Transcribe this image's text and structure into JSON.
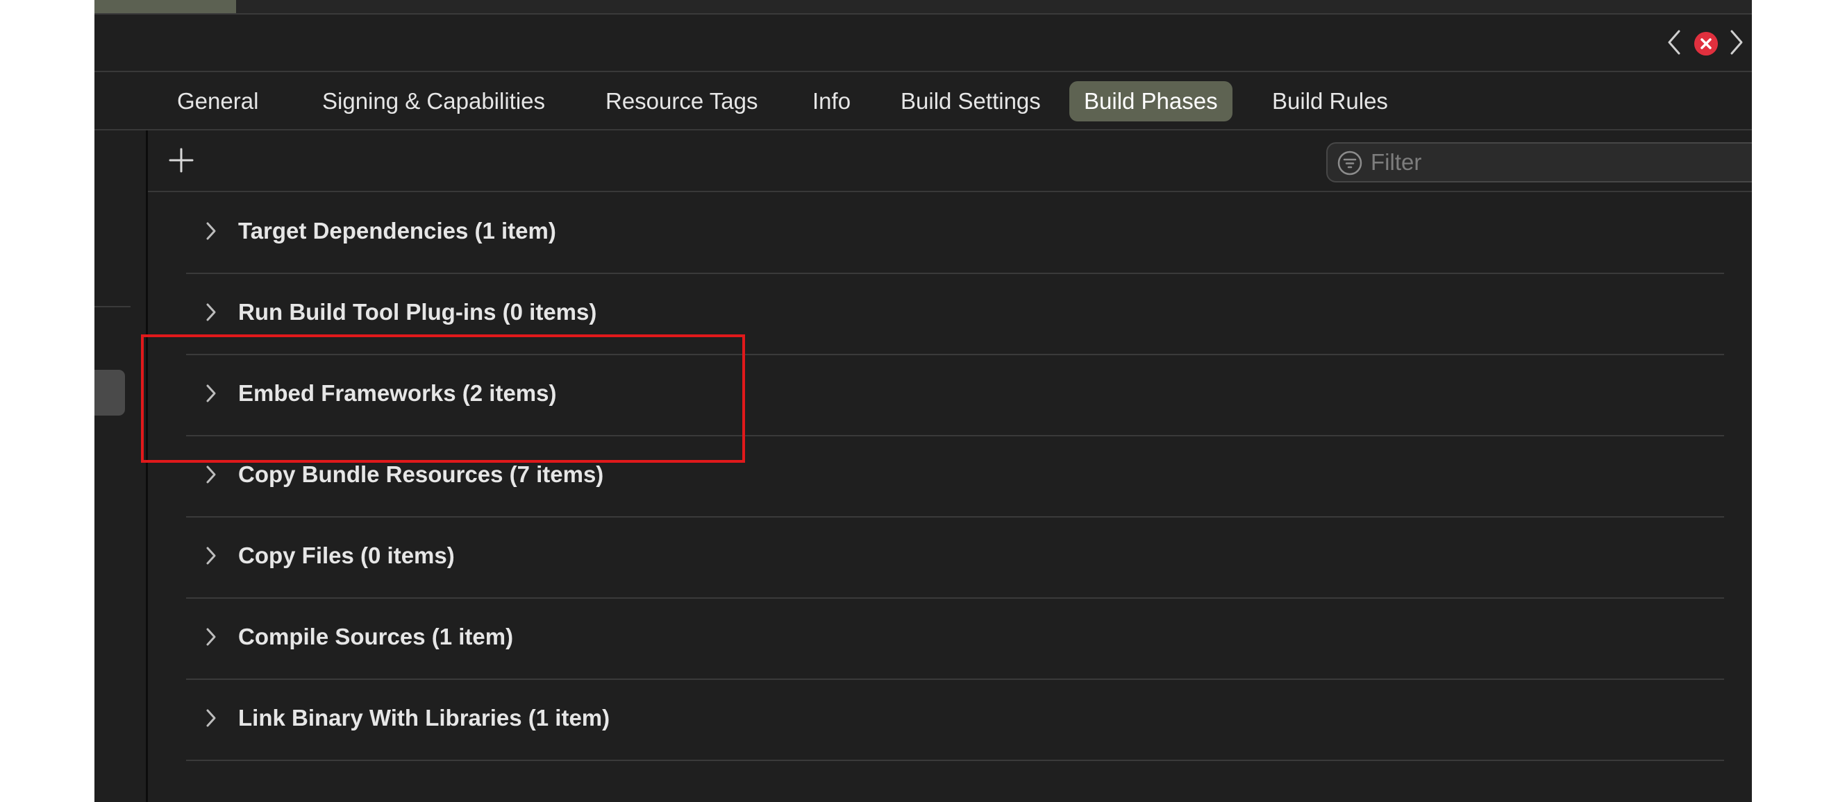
{
  "nav": {
    "back_icon": "chevron-left-icon",
    "forward_icon": "chevron-right-icon",
    "issue_icon": "error-badge-icon",
    "issue_color": "#e0303e"
  },
  "tabs": [
    {
      "label": "General"
    },
    {
      "label": "Signing & Capabilities"
    },
    {
      "label": "Resource Tags"
    },
    {
      "label": "Info"
    },
    {
      "label": "Build Settings"
    },
    {
      "label": "Build Phases",
      "active": true
    },
    {
      "label": "Build Rules"
    }
  ],
  "toolbar": {
    "add_icon": "plus-icon",
    "filter_placeholder": "Filter",
    "filter_value": ""
  },
  "phases": [
    {
      "title": "Target Dependencies (1 item)",
      "deletable": false
    },
    {
      "title": "Run Build Tool Plug-ins (0 items)",
      "deletable": false
    },
    {
      "title": "Embed Frameworks (2 items)",
      "deletable": true,
      "highlighted": true
    },
    {
      "title": "Copy Bundle Resources (7 items)",
      "deletable": true
    },
    {
      "title": "Copy Files (0 items)",
      "deletable": true
    },
    {
      "title": "Compile Sources (1 item)",
      "deletable": true
    },
    {
      "title": "Link Binary With Libraries (1 item)",
      "deletable": true
    }
  ],
  "colors": {
    "background": "#1f1f1f",
    "active_tab": "#5e6352",
    "text": "#e6e6e6",
    "highlight": "#e0191b"
  }
}
